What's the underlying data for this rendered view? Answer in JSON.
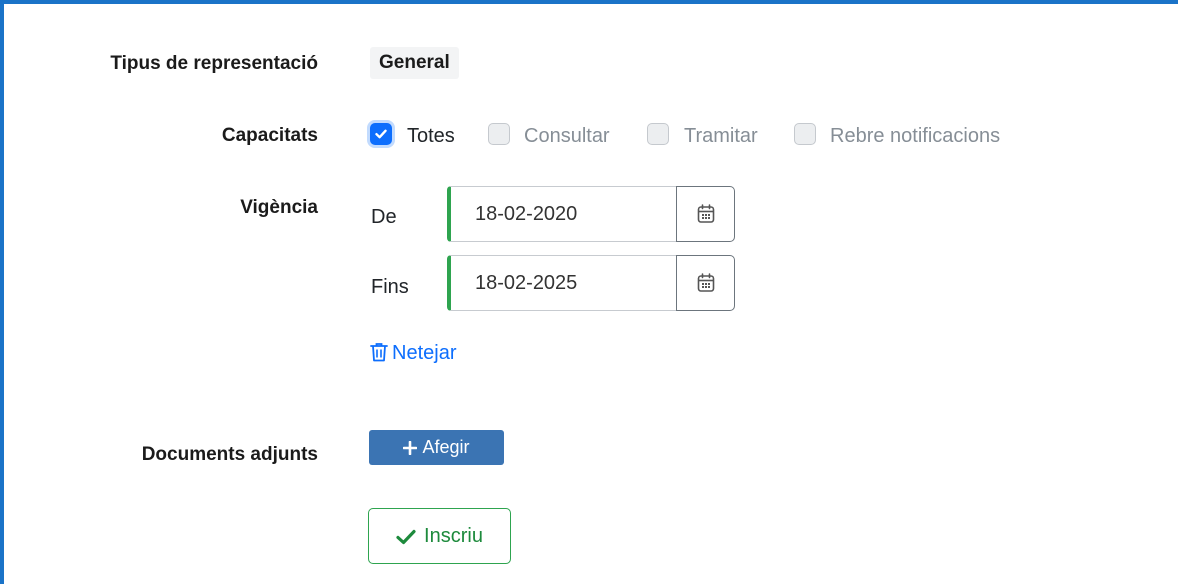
{
  "form": {
    "representation_type_label": "Tipus de representació",
    "representation_type_value": "General",
    "capabilities_label": "Capacitats",
    "capabilities": [
      {
        "label": "Totes",
        "checked": true
      },
      {
        "label": "Consultar",
        "checked": false
      },
      {
        "label": "Tramitar",
        "checked": false
      },
      {
        "label": "Rebre notificacions",
        "checked": false
      }
    ],
    "validity_label": "Vigència",
    "from_label": "De",
    "from_value": "18-02-2020",
    "to_label": "Fins",
    "to_value": "18-02-2025",
    "clear_label": "Netejar",
    "attachments_label": "Documents adjunts",
    "add_label": "Afegir",
    "submit_label": "Inscriu"
  },
  "icons": {
    "checkbox_check": "check-icon",
    "calendar": "calendar-icon",
    "clear": "trash-icon",
    "add": "plus-icon",
    "submit": "check-icon"
  },
  "colors": {
    "frame_border": "#1a73c8",
    "primary": "#0d6efd",
    "add_button": "#3b74b3",
    "success": "#2ea44f"
  }
}
